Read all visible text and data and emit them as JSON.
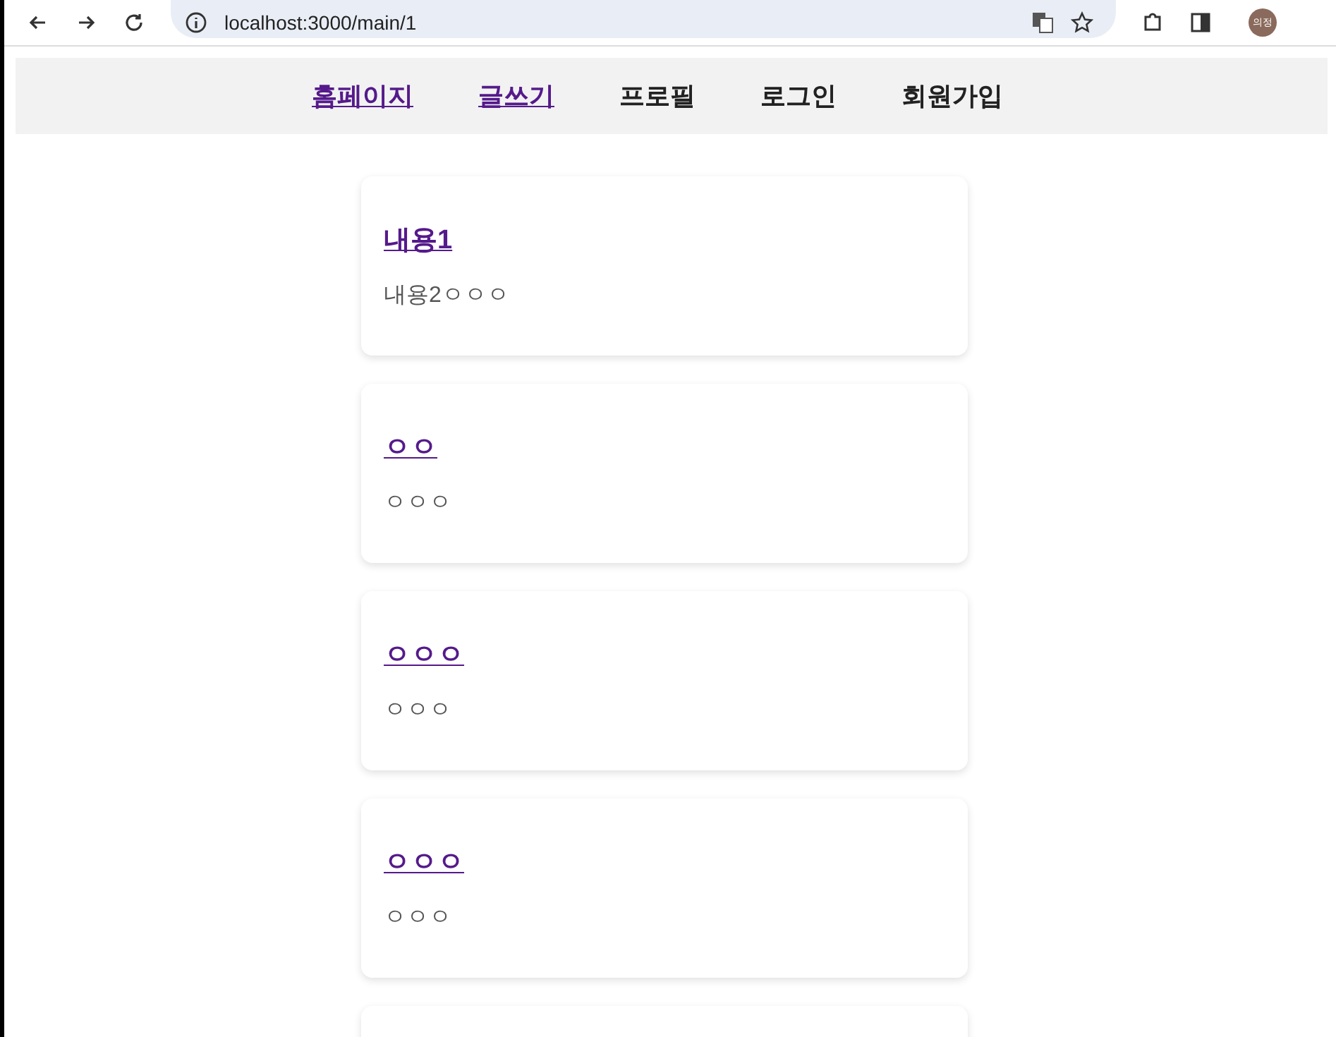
{
  "browser": {
    "url": "localhost:3000/main/1",
    "profile_initials": "의정"
  },
  "nav": [
    {
      "label": "홈페이지",
      "visited": true
    },
    {
      "label": "글쓰기",
      "visited": true
    },
    {
      "label": "프로필",
      "visited": false
    },
    {
      "label": "로그인",
      "visited": false
    },
    {
      "label": "회원가입",
      "visited": false
    }
  ],
  "posts": [
    {
      "title": "내용1",
      "body": "내용2ㅇㅇㅇ"
    },
    {
      "title": "ㅇㅇ",
      "body": "ㅇㅇㅇ"
    },
    {
      "title": "ㅇㅇㅇ",
      "body": "ㅇㅇㅇ"
    },
    {
      "title": "ㅇㅇㅇ",
      "body": "ㅇㅇㅇ"
    }
  ]
}
